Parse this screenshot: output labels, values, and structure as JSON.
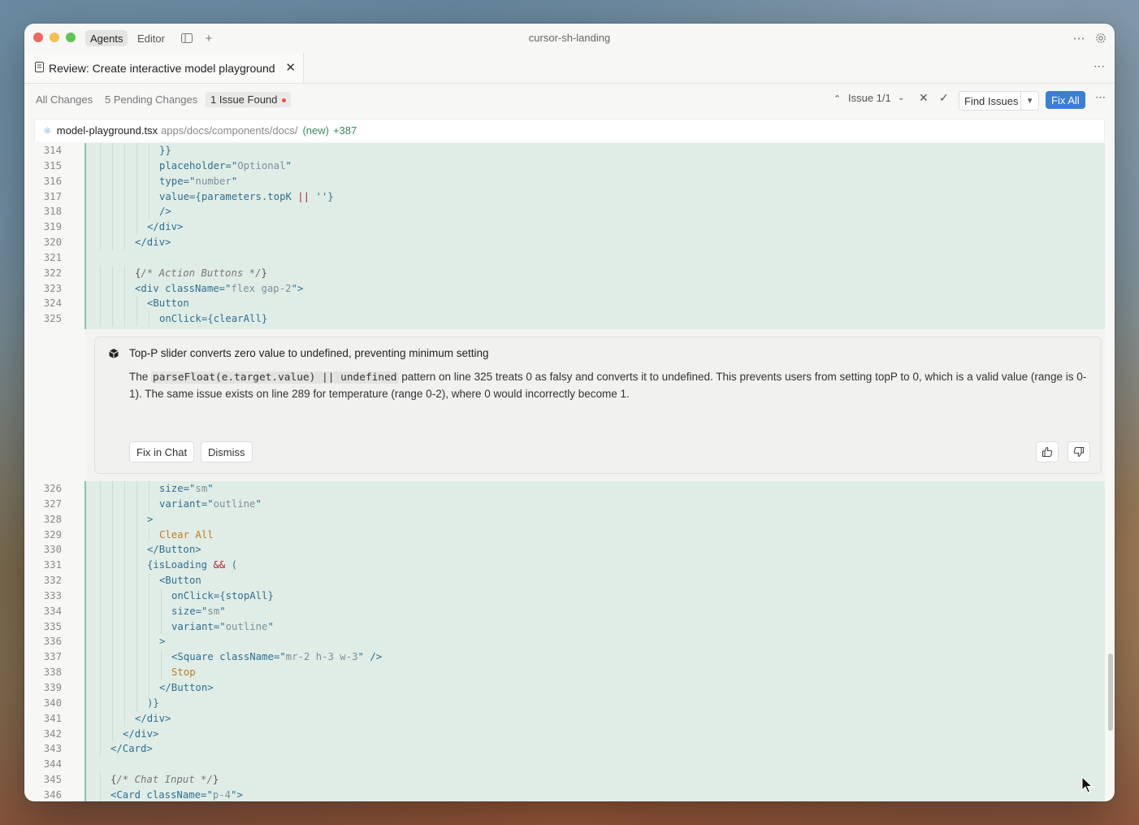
{
  "window": {
    "title": "cursor-sh-landing",
    "modes": {
      "agents": "Agents",
      "editor": "Editor"
    }
  },
  "tab": {
    "title": "Review: Create interactive model playground"
  },
  "review": {
    "filters": {
      "all": "All Changes",
      "pending": "5 Pending Changes",
      "issues": "1 Issue Found"
    },
    "issue_nav": "Issue 1/1",
    "find_issues": "Find Issues",
    "fix_all": "Fix All"
  },
  "file": {
    "name": "model-playground.tsx",
    "path": "apps/docs/components/docs/",
    "status": "(new)",
    "additions": "+387"
  },
  "code_top": [
    {
      "n": "314",
      "indent": 10,
      "t": "}}"
    },
    {
      "n": "315",
      "indent": 10,
      "t": "placeholder=\"Optional\""
    },
    {
      "n": "316",
      "indent": 10,
      "t": "type=\"number\""
    },
    {
      "n": "317",
      "indent": 10,
      "t": "value={parameters.topK || ''}"
    },
    {
      "n": "318",
      "indent": 10,
      "t": "/>"
    },
    {
      "n": "319",
      "indent": 8,
      "t": "</div>"
    },
    {
      "n": "320",
      "indent": 6,
      "t": "</div>"
    },
    {
      "n": "321",
      "indent": 0,
      "t": ""
    },
    {
      "n": "322",
      "indent": 6,
      "t": "{/* Action Buttons */}"
    },
    {
      "n": "323",
      "indent": 6,
      "t": "<div className=\"flex gap-2\">"
    },
    {
      "n": "324",
      "indent": 8,
      "t": "<Button"
    },
    {
      "n": "325",
      "indent": 10,
      "t": "onClick={clearAll}"
    }
  ],
  "issue": {
    "title": "Top-P slider converts zero value to undefined, preventing minimum setting",
    "body_pre": "The ",
    "body_code": "parseFloat(e.target.value) || undefined",
    "body_post": " pattern on line 325 treats 0 as falsy and converts it to undefined. This prevents users from setting topP to 0, which is a valid value (range is 0-1). The same issue exists on line 289 for temperature (range 0-2), where 0 would incorrectly become 1.",
    "fix_in_chat": "Fix in Chat",
    "dismiss": "Dismiss"
  },
  "code_bottom": [
    {
      "n": "326",
      "indent": 10,
      "t": "size=\"sm\""
    },
    {
      "n": "327",
      "indent": 10,
      "t": "variant=\"outline\""
    },
    {
      "n": "328",
      "indent": 8,
      "t": ">"
    },
    {
      "n": "329",
      "indent": 10,
      "t": "Clear All"
    },
    {
      "n": "330",
      "indent": 8,
      "t": "</Button>"
    },
    {
      "n": "331",
      "indent": 8,
      "t": "{isLoading && ("
    },
    {
      "n": "332",
      "indent": 10,
      "t": "<Button"
    },
    {
      "n": "333",
      "indent": 12,
      "t": "onClick={stopAll}"
    },
    {
      "n": "334",
      "indent": 12,
      "t": "size=\"sm\""
    },
    {
      "n": "335",
      "indent": 12,
      "t": "variant=\"outline\""
    },
    {
      "n": "336",
      "indent": 10,
      "t": ">"
    },
    {
      "n": "337",
      "indent": 12,
      "t": "<Square className=\"mr-2 h-3 w-3\" />"
    },
    {
      "n": "338",
      "indent": 12,
      "t": "Stop"
    },
    {
      "n": "339",
      "indent": 10,
      "t": "</Button>"
    },
    {
      "n": "340",
      "indent": 8,
      "t": ")}"
    },
    {
      "n": "341",
      "indent": 6,
      "t": "</div>"
    },
    {
      "n": "342",
      "indent": 4,
      "t": "</div>"
    },
    {
      "n": "343",
      "indent": 2,
      "t": "</Card>"
    },
    {
      "n": "344",
      "indent": 0,
      "t": ""
    },
    {
      "n": "345",
      "indent": 2,
      "t": "{/* Chat Input */}"
    },
    {
      "n": "346",
      "indent": 2,
      "t": "<Card className=\"p-4\">"
    }
  ],
  "colors": {
    "accent": "#3c7ed6",
    "added_bg": "#e0ede7",
    "added_bar": "#86c7a0",
    "issue_dot": "#e5534b"
  }
}
